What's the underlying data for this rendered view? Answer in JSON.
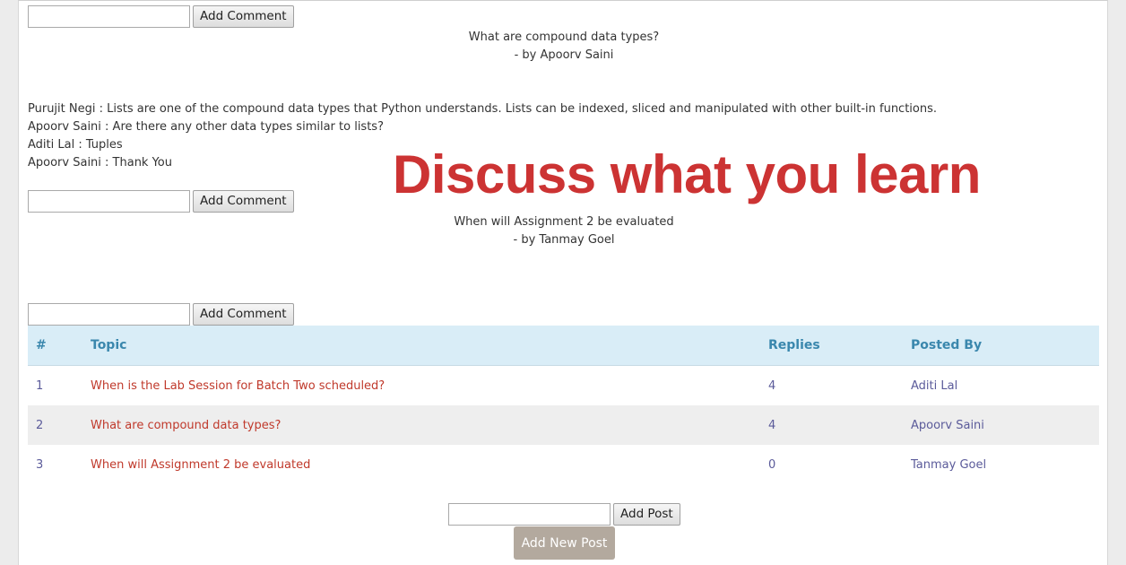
{
  "forms": {
    "comment_label": "Add Comment",
    "comment_value": "",
    "post_label": "Add Post",
    "post_value": "",
    "new_post_label": "Add New Post"
  },
  "posts": [
    {
      "title": "What are compound data types?",
      "author_line": "- by Apoorv Saini",
      "comments": [
        "Purujit Negi : Lists are one of the compound data types that Python understands. Lists can be indexed, sliced and manipulated with other built-in functions.",
        "Apoorv Saini : Are there any other data types similar to lists?",
        "Aditi Lal : Tuples",
        "Apoorv Saini : Thank You"
      ]
    },
    {
      "title": "When will Assignment 2 be evaluated",
      "author_line": "- by Tanmay Goel",
      "comments": []
    }
  ],
  "overlay_text": "Discuss what you learn",
  "table": {
    "headers": [
      "#",
      "Topic",
      "Replies",
      "Posted By"
    ],
    "rows": [
      {
        "num": "1",
        "topic": "When is the Lab Session for Batch Two scheduled?",
        "replies": "4",
        "posted_by": "Aditi Lal"
      },
      {
        "num": "2",
        "topic": "What are compound data types?",
        "replies": "4",
        "posted_by": "Apoorv Saini"
      },
      {
        "num": "3",
        "topic": "When will Assignment 2 be evaluated",
        "replies": "0",
        "posted_by": "Tanmay Goel"
      }
    ]
  },
  "colors": {
    "overlay": "#cc3333",
    "header_bg": "#d9edf7",
    "header_text": "#3a87ad",
    "topic_link": "#c0392b",
    "new_post_button": "#b3a99e"
  }
}
